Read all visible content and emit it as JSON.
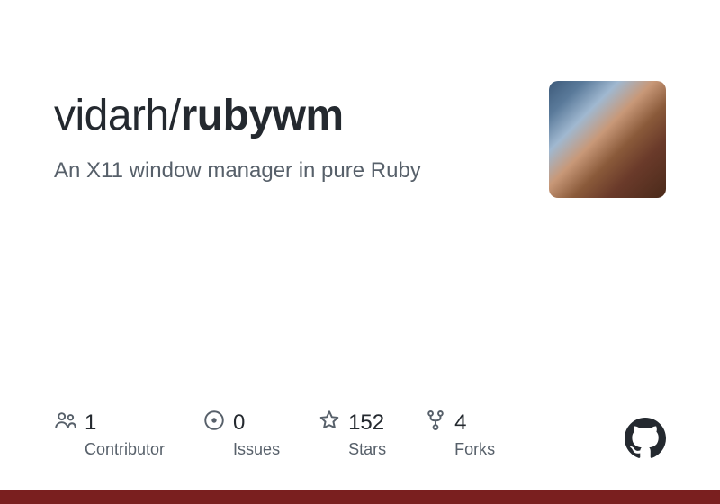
{
  "repo": {
    "owner": "vidarh",
    "separator": "/",
    "name": "rubywm",
    "description": "An X11 window manager in pure Ruby"
  },
  "stats": {
    "contributors": {
      "value": "1",
      "label": "Contributor"
    },
    "issues": {
      "value": "0",
      "label": "Issues"
    },
    "stars": {
      "value": "152",
      "label": "Stars"
    },
    "forks": {
      "value": "4",
      "label": "Forks"
    }
  },
  "colors": {
    "accent_bar": "#7a1f1f"
  }
}
